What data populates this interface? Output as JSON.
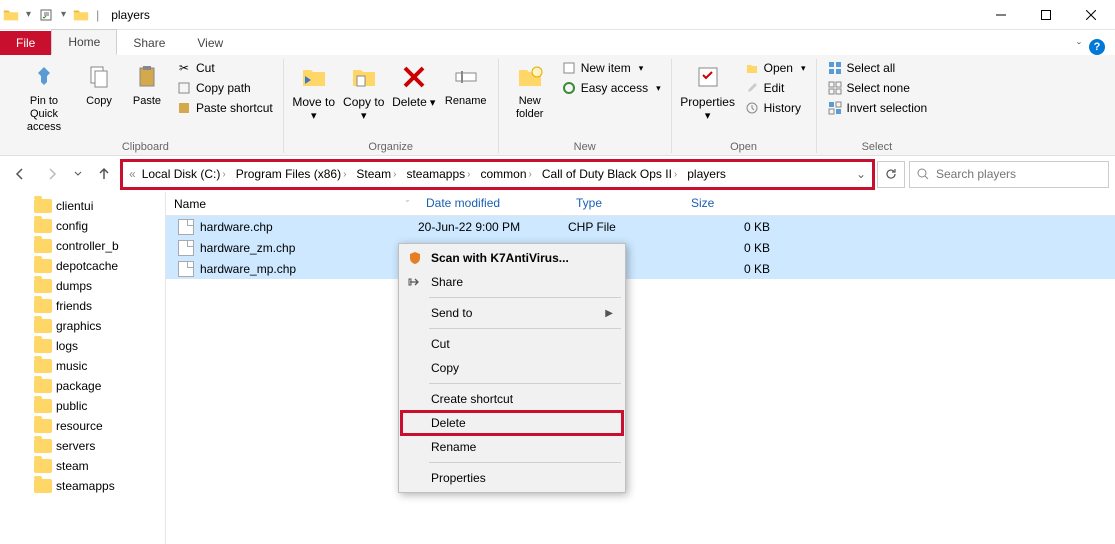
{
  "window": {
    "title": "players"
  },
  "tabs": {
    "file": "File",
    "home": "Home",
    "share": "Share",
    "view": "View"
  },
  "ribbon": {
    "clipboard": {
      "label": "Clipboard",
      "pin": "Pin to Quick access",
      "copy": "Copy",
      "paste": "Paste",
      "cut": "Cut",
      "copypath": "Copy path",
      "pasteshortcut": "Paste shortcut"
    },
    "organize": {
      "label": "Organize",
      "moveto": "Move to",
      "copyto": "Copy to",
      "delete": "Delete",
      "rename": "Rename"
    },
    "new": {
      "label": "New",
      "newfolder": "New folder",
      "newitem": "New item",
      "easyaccess": "Easy access"
    },
    "open": {
      "label": "Open",
      "properties": "Properties",
      "open": "Open",
      "edit": "Edit",
      "history": "History"
    },
    "select": {
      "label": "Select",
      "selectall": "Select all",
      "selectnone": "Select none",
      "invert": "Invert selection"
    }
  },
  "breadcrumbs": [
    "Local Disk (C:)",
    "Program Files (x86)",
    "Steam",
    "steamapps",
    "common",
    "Call of Duty Black Ops II",
    "players"
  ],
  "search": {
    "placeholder": "Search players"
  },
  "columns": {
    "name": "Name",
    "date": "Date modified",
    "type": "Type",
    "size": "Size"
  },
  "files": [
    {
      "name": "hardware.chp",
      "date": "20-Jun-22 9:00 PM",
      "type": "CHP File",
      "size": "0 KB"
    },
    {
      "name": "hardware_zm.chp",
      "date": "",
      "type": "",
      "size": "0 KB"
    },
    {
      "name": "hardware_mp.chp",
      "date": "",
      "type": "",
      "size": "0 KB"
    }
  ],
  "sidebar": [
    "clientui",
    "config",
    "controller_b",
    "depotcache",
    "dumps",
    "friends",
    "graphics",
    "logs",
    "music",
    "package",
    "public",
    "resource",
    "servers",
    "steam",
    "steamapps"
  ],
  "context": {
    "scan": "Scan with K7AntiVirus...",
    "share": "Share",
    "sendto": "Send to",
    "cut": "Cut",
    "copy": "Copy",
    "createshortcut": "Create shortcut",
    "delete": "Delete",
    "rename": "Rename",
    "properties": "Properties"
  }
}
